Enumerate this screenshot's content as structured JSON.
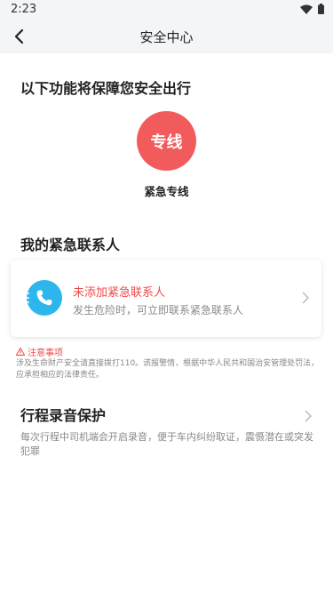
{
  "status_bar": {
    "time": "2:23"
  },
  "nav": {
    "title": "安全中心"
  },
  "safety_section": {
    "title": "以下功能将保障您安全出行",
    "hotline_button_label": "专线",
    "hotline_caption": "紧急专线"
  },
  "contacts_section": {
    "title": "我的紧急联系人",
    "card_title": "未添加紧急联系人",
    "card_subtitle": "发生危险时，可立即联系紧急联系人"
  },
  "notice": {
    "title": "注意事项",
    "body": "涉及生命财产安全请直接拨打110。谎报警情，根据中华人民共和国治安管理处罚法，应承担相应的法律责任。"
  },
  "recording": {
    "title": "行程录音保护",
    "body": "每次行程中司机端会开启录音，便于车内纠纷取证，震慑潜在或突发犯罪"
  },
  "colors": {
    "accent_red": "#f25b5b",
    "phone_blue": "#2cb6ec",
    "header_bg": "#f4f5f7"
  }
}
